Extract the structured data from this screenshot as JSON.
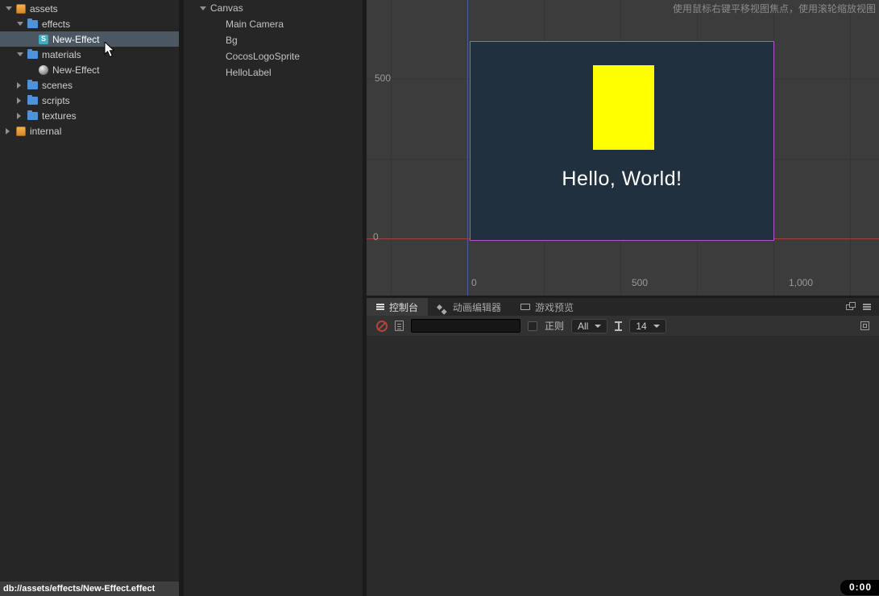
{
  "assets_panel": {
    "tree": [
      {
        "label": "assets"
      },
      {
        "label": "effects"
      },
      {
        "label": "New-Effect"
      },
      {
        "label": "materials"
      },
      {
        "label": "New-Effect"
      },
      {
        "label": "scenes"
      },
      {
        "label": "scripts"
      },
      {
        "label": "textures"
      },
      {
        "label": "internal"
      }
    ],
    "effect_icon_letter": "S",
    "status_path": "db://assets/effects/New-Effect.effect"
  },
  "hierarchy_panel": {
    "nodes": [
      {
        "label": "Canvas"
      },
      {
        "label": "Main Camera"
      },
      {
        "label": "Bg"
      },
      {
        "label": "CocosLogoSprite"
      },
      {
        "label": "HelloLabel"
      }
    ]
  },
  "scene_view": {
    "hint": "使用鼠标右键平移视图焦点，使用滚轮缩放视图",
    "ruler_left": [
      "500",
      "0"
    ],
    "ruler_bottom": [
      "0",
      "500",
      "1,000"
    ],
    "stage_text": "Hello, World!",
    "colors": {
      "stage_bg": "#21303f",
      "stage_border": "#b351cc",
      "sprite": "#ffff00",
      "axis_x": "#a24040",
      "axis_y": "#4a5a9e"
    }
  },
  "console_panel": {
    "tabs": [
      {
        "label": "控制台"
      },
      {
        "label": "动画编辑器"
      },
      {
        "label": "游戏预览"
      }
    ],
    "toolbar": {
      "search_value": "",
      "regex_label": "正则",
      "type_filter": "All",
      "font_size": "14"
    }
  },
  "timer": "0:00"
}
